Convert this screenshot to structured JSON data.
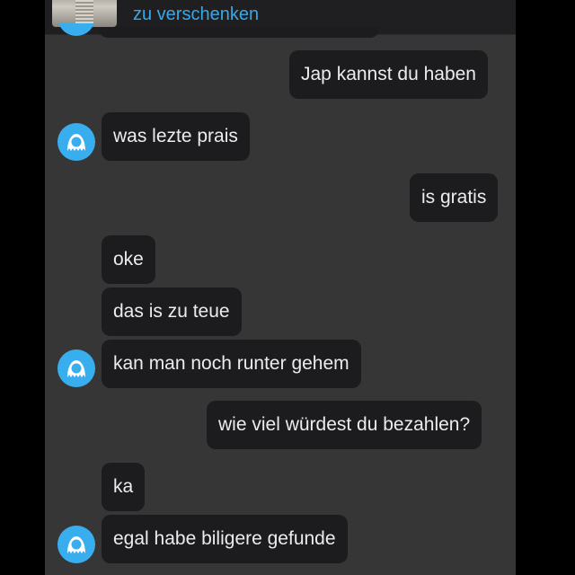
{
  "listing": {
    "title": "zu verschenken"
  },
  "colors": {
    "accent": "#3aa7e8",
    "avatar": "#39aeee",
    "bubble": "#1c1c1e",
    "background": "#363636"
  },
  "messages": [
    {
      "sender": "me",
      "text": "Jap kannst du haben"
    },
    {
      "sender": "other",
      "text": "was lezte prais"
    },
    {
      "sender": "me",
      "text": "is gratis"
    },
    {
      "sender": "other",
      "text": "oke"
    },
    {
      "sender": "other",
      "text": "das is zu teue"
    },
    {
      "sender": "other",
      "text": "kan man noch runter gehem"
    },
    {
      "sender": "me",
      "text": "wie viel würdest du bezahlen?"
    },
    {
      "sender": "other",
      "text": "ka"
    },
    {
      "sender": "other",
      "text": "egal habe biligere gefunde"
    }
  ],
  "icons": {
    "avatar": "user-avatar-icon"
  }
}
